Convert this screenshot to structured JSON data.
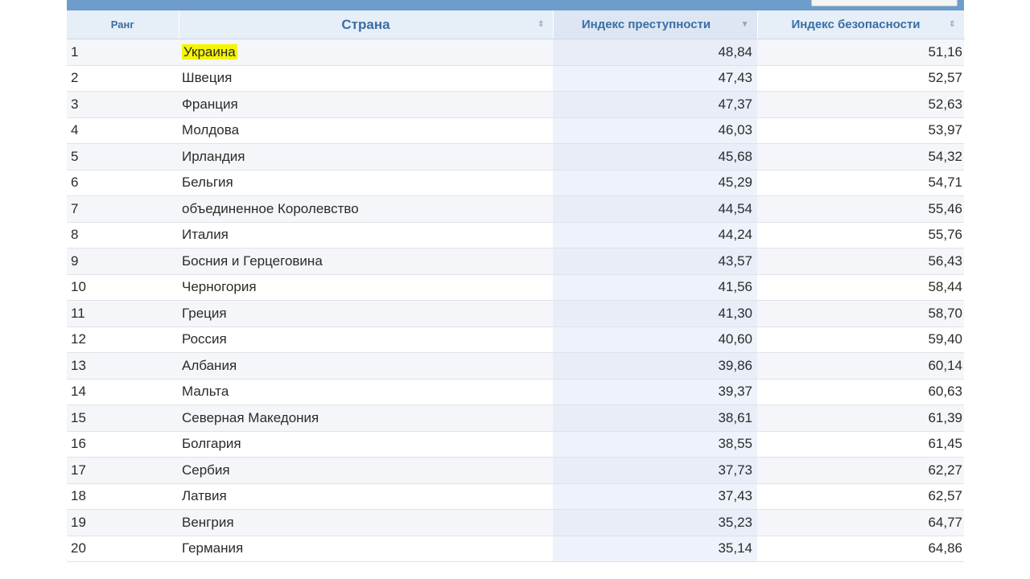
{
  "table": {
    "columns": {
      "rank": "Ранг",
      "country": "Страна",
      "crime_index": "Индекс преступности",
      "safety_index": "Индекс безопасности"
    },
    "highlight_color": "#f5f500",
    "header_text_color": "#3a6ea5",
    "rows": [
      {
        "rank": "1",
        "country": "Украина",
        "crime": "48,84",
        "safety": "51,16",
        "highlighted": true
      },
      {
        "rank": "2",
        "country": "Швеция",
        "crime": "47,43",
        "safety": "52,57"
      },
      {
        "rank": "3",
        "country": "Франция",
        "crime": "47,37",
        "safety": "52,63"
      },
      {
        "rank": "4",
        "country": "Молдова",
        "crime": "46,03",
        "safety": "53,97"
      },
      {
        "rank": "5",
        "country": "Ирландия",
        "crime": "45,68",
        "safety": "54,32"
      },
      {
        "rank": "6",
        "country": "Бельгия",
        "crime": "45,29",
        "safety": "54,71"
      },
      {
        "rank": "7",
        "country": "объединенное Королевство",
        "crime": "44,54",
        "safety": "55,46"
      },
      {
        "rank": "8",
        "country": "Италия",
        "crime": "44,24",
        "safety": "55,76"
      },
      {
        "rank": "9",
        "country": "Босния и Герцеговина",
        "crime": "43,57",
        "safety": "56,43"
      },
      {
        "rank": "10",
        "country": "Черногория",
        "crime": "41,56",
        "safety": "58,44"
      },
      {
        "rank": "11",
        "country": "Греция",
        "crime": "41,30",
        "safety": "58,70"
      },
      {
        "rank": "12",
        "country": "Россия",
        "crime": "40,60",
        "safety": "59,40"
      },
      {
        "rank": "13",
        "country": "Албания",
        "crime": "39,86",
        "safety": "60,14"
      },
      {
        "rank": "14",
        "country": "Мальта",
        "crime": "39,37",
        "safety": "60,63"
      },
      {
        "rank": "15",
        "country": "Северная Македония",
        "crime": "38,61",
        "safety": "61,39"
      },
      {
        "rank": "16",
        "country": "Болгария",
        "crime": "38,55",
        "safety": "61,45"
      },
      {
        "rank": "17",
        "country": "Сербия",
        "crime": "37,73",
        "safety": "62,27"
      },
      {
        "rank": "18",
        "country": "Латвия",
        "crime": "37,43",
        "safety": "62,57"
      },
      {
        "rank": "19",
        "country": "Венгрия",
        "crime": "35,23",
        "safety": "64,77"
      },
      {
        "rank": "20",
        "country": "Германия",
        "crime": "35,14",
        "safety": "64,86"
      }
    ]
  }
}
